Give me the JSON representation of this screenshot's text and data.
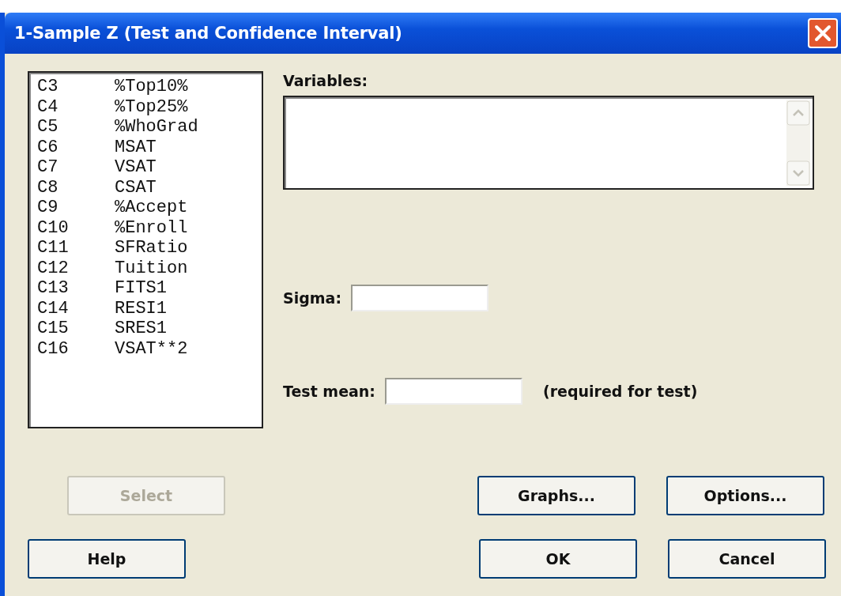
{
  "window": {
    "title": "1-Sample Z (Test and Confidence Interval)"
  },
  "columns": [
    {
      "number": "C3",
      "name": "%Top10%"
    },
    {
      "number": "C4",
      "name": "%Top25%"
    },
    {
      "number": "C5",
      "name": "%WhoGrad"
    },
    {
      "number": "C6",
      "name": "MSAT"
    },
    {
      "number": "C7",
      "name": "VSAT"
    },
    {
      "number": "C8",
      "name": "CSAT"
    },
    {
      "number": "C9",
      "name": "%Accept"
    },
    {
      "number": "C10",
      "name": "%Enroll"
    },
    {
      "number": "C11",
      "name": "SFRatio"
    },
    {
      "number": "C12",
      "name": "Tuition"
    },
    {
      "number": "C13",
      "name": "FITS1"
    },
    {
      "number": "C14",
      "name": "RESI1"
    },
    {
      "number": "C15",
      "name": "SRES1"
    },
    {
      "number": "C16",
      "name": "VSAT**2"
    }
  ],
  "variables": {
    "label": "Variables:"
  },
  "sigma": {
    "label": "Sigma:"
  },
  "test_mean": {
    "label": "Test mean:",
    "note": "(required for test)"
  },
  "buttons_row1": [
    {
      "label": "Select",
      "disabled": true
    },
    {
      "label": "Graphs...",
      "disabled": false
    },
    {
      "label": "Options...",
      "disabled": false
    }
  ],
  "buttons_row2": [
    {
      "label": "Help",
      "disabled": false
    },
    {
      "label": "OK",
      "disabled": false
    },
    {
      "label": "Cancel",
      "disabled": false
    }
  ]
}
